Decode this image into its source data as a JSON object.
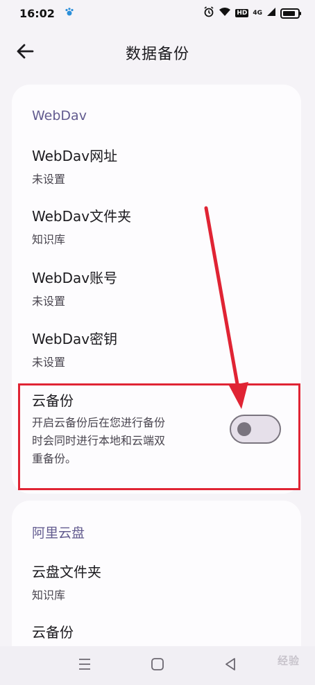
{
  "status_bar": {
    "time": "16:02",
    "hd": "HD",
    "network": "4G"
  },
  "app_bar": {
    "title": "数据备份"
  },
  "webdav_section": {
    "header": "WebDav",
    "items": [
      {
        "title": "WebDav网址",
        "summary": "未设置"
      },
      {
        "title": "WebDav文件夹",
        "summary": "知识库"
      },
      {
        "title": "WebDav账号",
        "summary": "未设置"
      },
      {
        "title": "WebDav密钥",
        "summary": "未设置"
      }
    ],
    "cloud_backup": {
      "title": "云备份",
      "summary_lines": [
        "开启云备份后在您进行备份",
        "时会同时进行本地和云端双",
        "重备份。"
      ],
      "enabled": false
    }
  },
  "aliyun_section": {
    "header": "阿里云盘",
    "items": [
      {
        "title": "云盘文件夹",
        "summary": "知识库"
      },
      {
        "title": "云备份",
        "summary": ""
      }
    ]
  },
  "watermark": "经验",
  "colors": {
    "accent": "#625b8f",
    "annotation": "#e02434",
    "background": "#f5f3f7",
    "card": "#fdfcfe"
  },
  "icons": {
    "back": "arrow-left-icon",
    "nav_menu": "menu-icon",
    "nav_home": "home-icon",
    "nav_back": "back-triangle-icon"
  }
}
